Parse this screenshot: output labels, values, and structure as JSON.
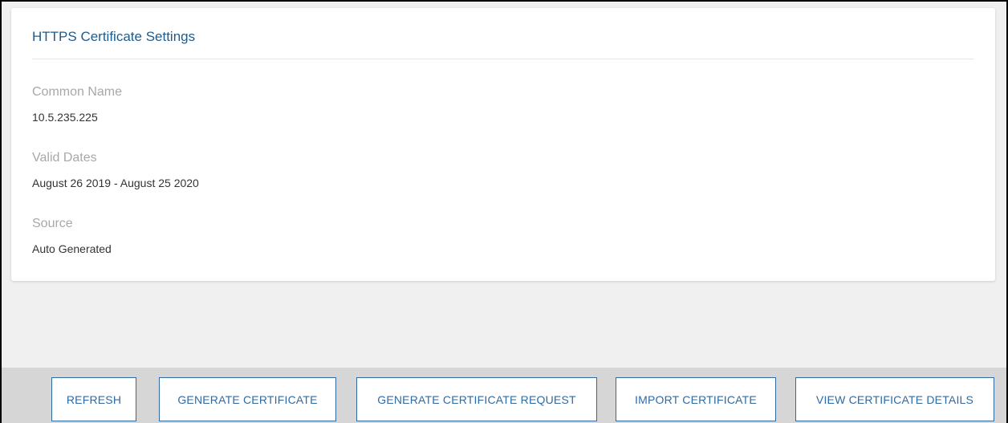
{
  "card": {
    "title": "HTTPS Certificate Settings",
    "fields": [
      {
        "label": "Common Name",
        "value": "10.5.235.225"
      },
      {
        "label": "Valid Dates",
        "value": "August 26 2019 - August 25 2020"
      },
      {
        "label": "Source",
        "value": "Auto Generated"
      }
    ]
  },
  "footer": {
    "buttons": [
      {
        "label": "REFRESH"
      },
      {
        "label": "GENERATE CERTIFICATE"
      },
      {
        "label": "GENERATE CERTIFICATE REQUEST"
      },
      {
        "label": "IMPORT CERTIFICATE"
      },
      {
        "label": "VIEW CERTIFICATE DETAILS"
      }
    ]
  },
  "colors": {
    "title": "#1f5b8b",
    "label": "#a8a8a8",
    "button": "#2f6aa3",
    "footer_bg": "#d6d6d6",
    "page_bg": "#f0f0f0"
  }
}
